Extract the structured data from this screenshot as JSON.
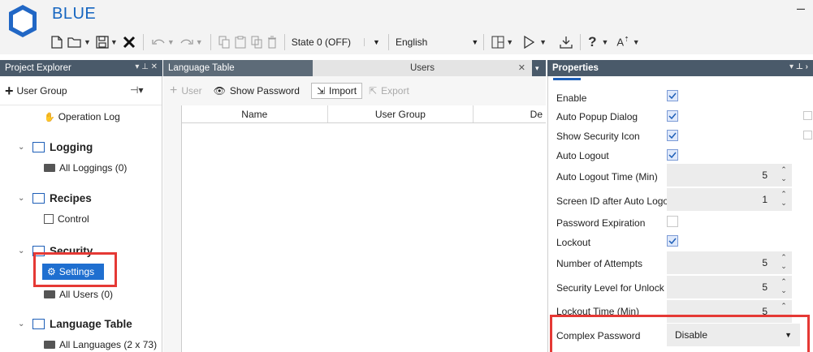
{
  "app": {
    "title": "BLUE"
  },
  "toolbar": {
    "state_select": "State 0 (OFF)",
    "language_select": "English"
  },
  "panels": {
    "project_explorer": "Project Explorer",
    "language_table_tab": "Language Table",
    "users_tab": "Users",
    "properties": "Properties"
  },
  "explorer": {
    "add_user_group": "User Group",
    "tree": {
      "operation_log": "Operation Log",
      "logging": "Logging",
      "all_loggings": "All Loggings (0)",
      "recipes": "Recipes",
      "control": "Control",
      "security": "Security",
      "settings": "Settings",
      "all_users": "All Users (0)",
      "language_table": "Language Table",
      "all_languages": "All Languages (2 x 73)"
    }
  },
  "users": {
    "toolbar": {
      "add_user": "User",
      "show_password": "Show Password",
      "import": "Import",
      "export": "Export"
    },
    "columns": [
      "Name",
      "User Group",
      "De"
    ]
  },
  "properties": {
    "enable": {
      "label": "Enable",
      "checked": true
    },
    "auto_popup": {
      "label": "Auto Popup Dialog",
      "checked": true
    },
    "show_security_icon": {
      "label": "Show Security Icon",
      "checked": true
    },
    "auto_logout": {
      "label": "Auto Logout",
      "checked": true
    },
    "auto_logout_time": {
      "label": "Auto Logout Time (Min)",
      "value": "5"
    },
    "screen_id_after_logout": {
      "label": "Screen ID after Auto Logout",
      "value": "1"
    },
    "password_expiration": {
      "label": "Password Expiration",
      "checked": false
    },
    "lockout": {
      "label": "Lockout",
      "checked": true
    },
    "number_of_attempts": {
      "label": "Number of Attempts",
      "value": "5"
    },
    "security_level_unlock": {
      "label": "Security Level for Unlock",
      "value": "5"
    },
    "lockout_time": {
      "label": "Lockout Time (Min)",
      "value": "5"
    },
    "complex_password": {
      "label": "Complex Password",
      "value": "Disable"
    }
  },
  "colors": {
    "accent": "#1565c0",
    "panel_header": "#4a5a6a",
    "selection": "#1f6fd0",
    "highlight_box": "#e53935"
  }
}
